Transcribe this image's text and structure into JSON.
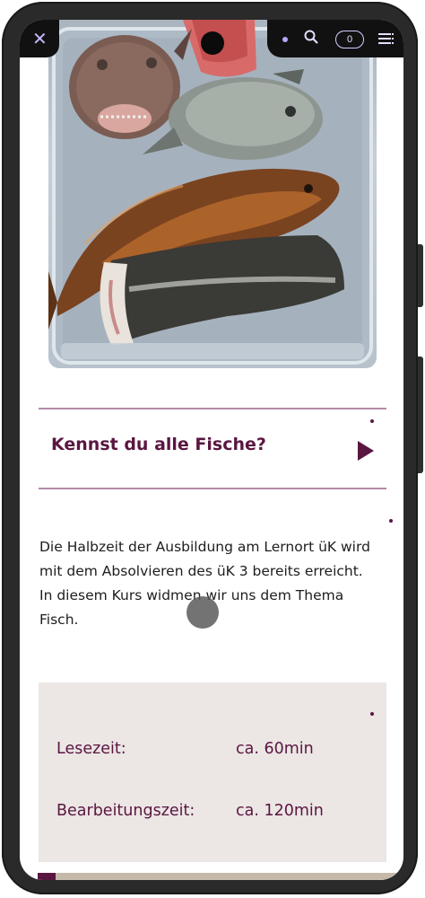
{
  "colors": {
    "accent": "#5a1640",
    "divider": "#b48aa6",
    "info_box_bg": "#ece6e5",
    "text": "#1d1d1d"
  },
  "status_bar": {
    "counter": "0",
    "icons": [
      "close-icon",
      "dot-icon",
      "search-icon",
      "menu-icon"
    ]
  },
  "hero": {
    "icon": "fish-photo"
  },
  "accordion": {
    "title": "Kennst du alle Fische?",
    "icon": "play-icon"
  },
  "intro": {
    "line1": "Die Halbzeit der Ausbildung am Lernort üK wird",
    "line2": "mit dem Absolvieren des üK 3 bereits erreicht.",
    "line3": "In diesem Kurs widmen wir uns dem Thema",
    "line4": "Fisch."
  },
  "info": {
    "reading_label": "Lesezeit:",
    "reading_value": "ca. 60min",
    "work_label": "Bearbeitungszeit:",
    "work_value": "ca. 120min"
  }
}
